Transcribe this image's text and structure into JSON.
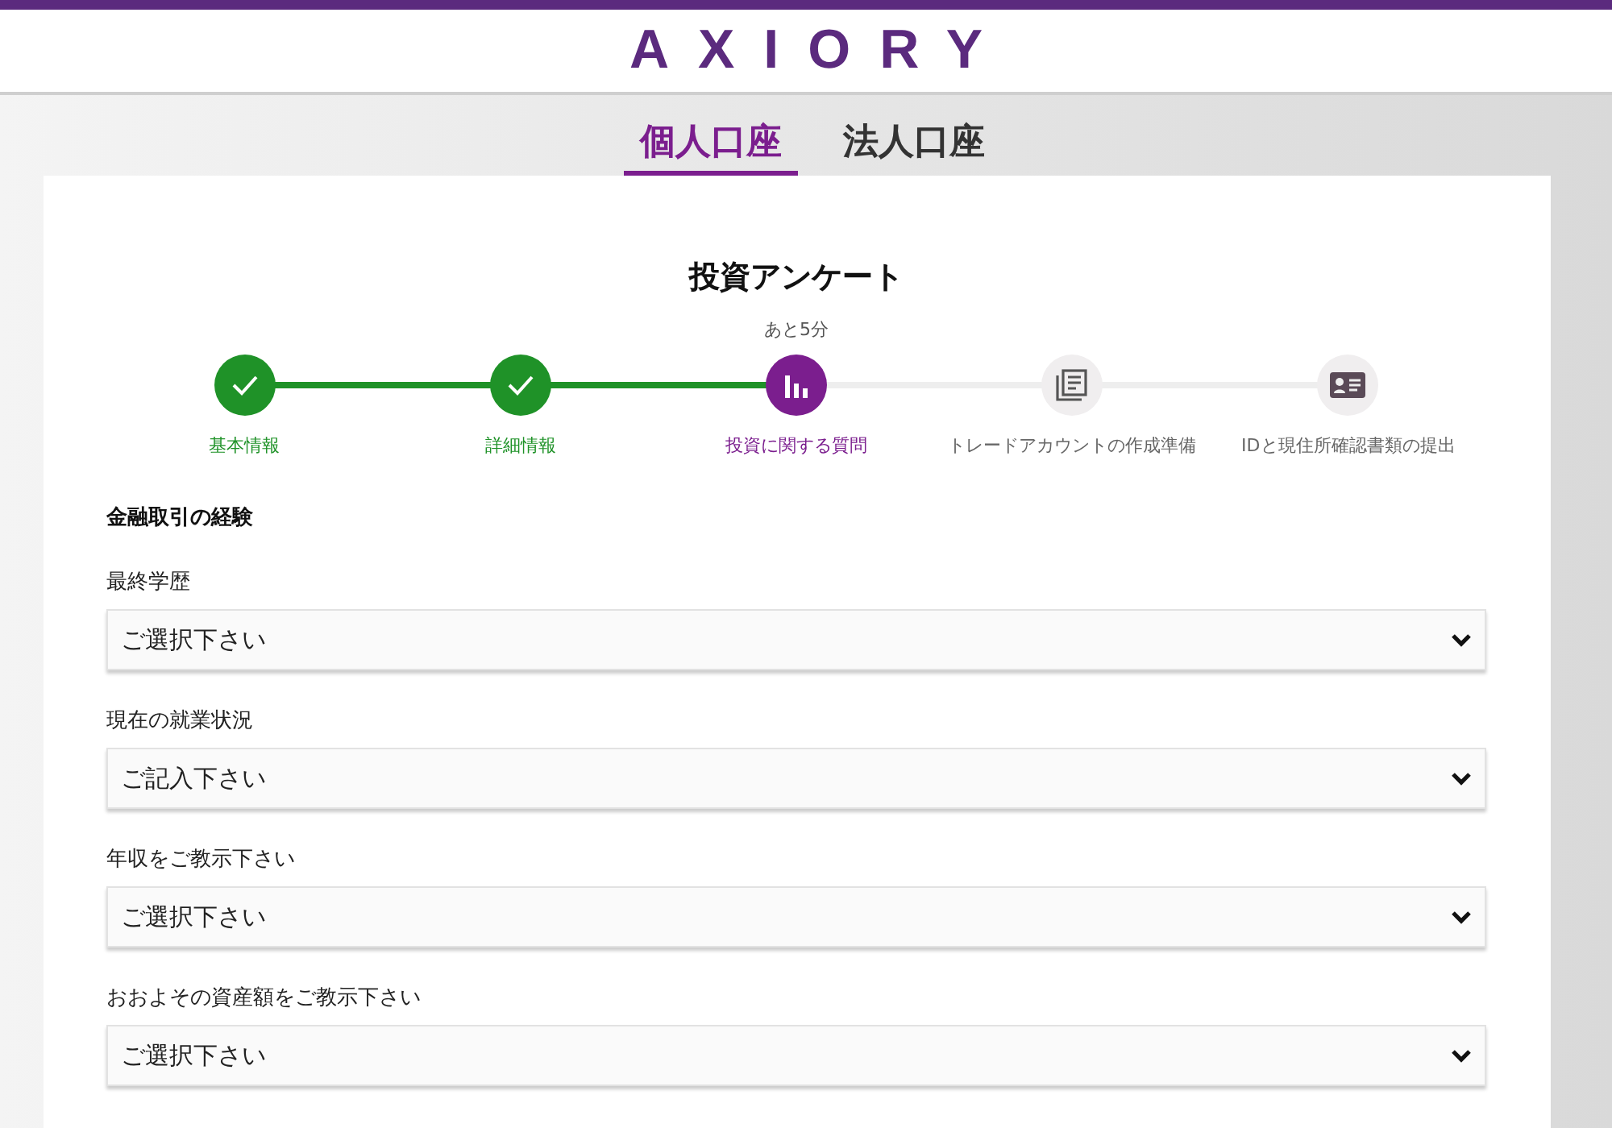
{
  "header": {
    "logo": "AXIORY"
  },
  "tabs": [
    {
      "label": "個人口座",
      "selected": true
    },
    {
      "label": "法人口座",
      "selected": false
    }
  ],
  "form": {
    "title": "投資アンケート",
    "time_left": "あと5分",
    "steps": [
      {
        "label": "基本情報",
        "completed": true,
        "selected": false
      },
      {
        "label": "詳細情報",
        "completed": true,
        "selected": false
      },
      {
        "label": "投資に関する質問",
        "completed": false,
        "selected": true
      },
      {
        "label": "トレードアカウントの作成準備",
        "completed": false,
        "selected": false
      },
      {
        "label": "IDと現住所確認書類の提出",
        "completed": false,
        "selected": false
      }
    ],
    "section_title": "金融取引の経験",
    "fields": [
      {
        "label": "最終学歴",
        "value": "ご選択下さい"
      },
      {
        "label": "現在の就業状況",
        "value": "ご記入下さい"
      },
      {
        "label": "年収をご教示下さい",
        "value": "ご選択下さい"
      },
      {
        "label": "おおよその資産額をご教示下さい",
        "value": "ご選択下さい"
      }
    ]
  }
}
